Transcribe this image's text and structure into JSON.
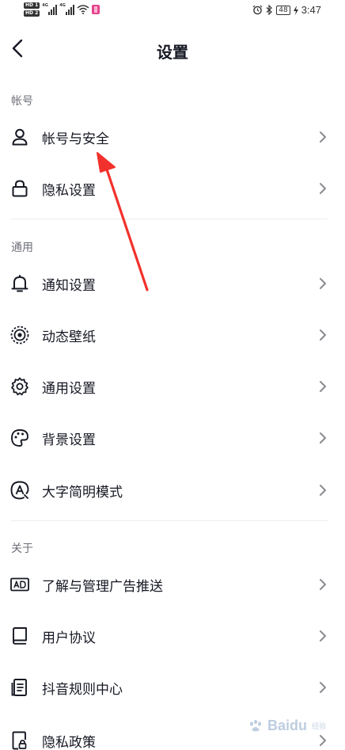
{
  "status_bar": {
    "hd1": "HD 1",
    "hd2": "HD 2",
    "net1": "4G",
    "net2": "4G",
    "battery": "48",
    "time": "3:47"
  },
  "header": {
    "title": "设置"
  },
  "sections": [
    {
      "title": "帐号",
      "items": [
        {
          "label": "帐号与安全",
          "icon": "person-icon"
        },
        {
          "label": "隐私设置",
          "icon": "lock-icon"
        }
      ]
    },
    {
      "title": "通用",
      "items": [
        {
          "label": "通知设置",
          "icon": "bell-icon"
        },
        {
          "label": "动态壁纸",
          "icon": "dynamic-wallpaper-icon"
        },
        {
          "label": "通用设置",
          "icon": "gear-icon"
        },
        {
          "label": "背景设置",
          "icon": "palette-icon"
        },
        {
          "label": "大字简明模式",
          "icon": "large-font-icon"
        }
      ]
    },
    {
      "title": "关于",
      "items": [
        {
          "label": "了解与管理广告推送",
          "icon": "ad-icon"
        },
        {
          "label": "用户协议",
          "icon": "book-icon"
        },
        {
          "label": "抖音规则中心",
          "icon": "rules-doc-icon"
        },
        {
          "label": "隐私政策",
          "icon": "privacy-doc-icon"
        }
      ]
    }
  ],
  "watermark": {
    "text": "Baidu",
    "sub": "经验"
  },
  "colors": {
    "text": "#161823",
    "section_title": "#6f7079",
    "chevron": "#8a8b91",
    "annotation_arrow": "#f2312c"
  }
}
